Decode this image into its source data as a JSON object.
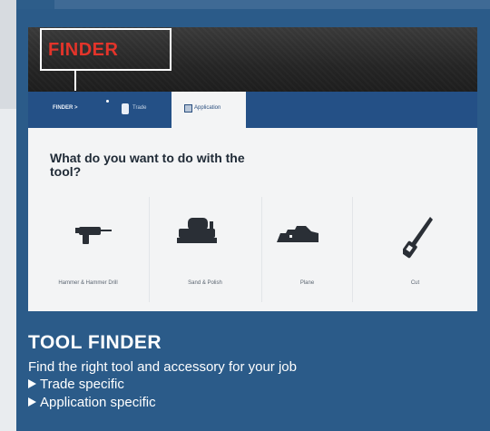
{
  "header": {
    "logo_text": "FINDER"
  },
  "nav": {
    "crumb_label": "FINDER >",
    "trade_label": "Trade",
    "application_label": "Application"
  },
  "main": {
    "question": "What do you want to do with the tool?",
    "categories": [
      {
        "label": "Hammer & Hammer Drill",
        "icon": "hammer-drill-icon"
      },
      {
        "label": "Sand & Polish",
        "icon": "sander-icon"
      },
      {
        "label": "Plane",
        "icon": "planer-icon"
      },
      {
        "label": "Cut",
        "icon": "saw-icon"
      }
    ]
  },
  "caption": {
    "title": "TOOL FINDER",
    "subtitle": "Find the right tool and accessory for your job",
    "bullets": [
      "Trade specific",
      "Application specific"
    ]
  },
  "colors": {
    "page_background": "#2d5d8a",
    "nav_background": "#245086",
    "logo_red": "#e3342a"
  }
}
